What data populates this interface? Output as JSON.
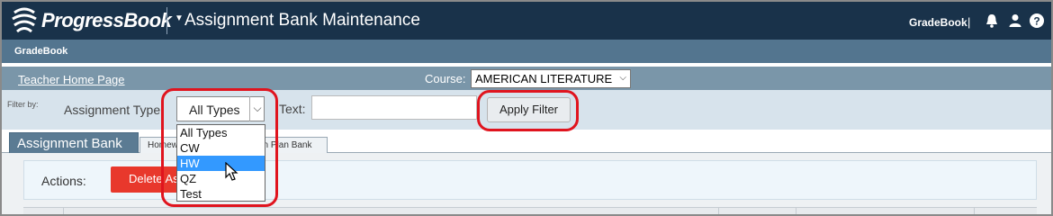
{
  "header": {
    "brand": "ProgressBook",
    "app_title": "Assignment Bank Maintenance",
    "gradebook_link": "GradeBook",
    "separator": "|",
    "icons": [
      "bell-icon",
      "user-icon",
      "help-icon"
    ]
  },
  "subbar": {
    "label": "GradeBook"
  },
  "nav": {
    "teacher_home": "Teacher Home Page",
    "course_label": "Course:",
    "course_value": "AMERICAN LITERATURE"
  },
  "filter": {
    "filter_by": "Filter by:",
    "assignment_type_label": "Assignment Type:",
    "assignment_type_value": "All Types",
    "text_label": "Text:",
    "text_value": "",
    "apply_button": "Apply Filter",
    "options": [
      "All Types",
      "CW",
      "HW",
      "QZ",
      "Test"
    ],
    "hovered_option": "HW"
  },
  "tabs": {
    "active": "Assignment Bank",
    "others": [
      "Homew",
      "on Plan Bank"
    ]
  },
  "actions": {
    "label": "Actions:",
    "delete_button": "Delete As"
  },
  "colors": {
    "header_bg": "#19324a",
    "subbar_bg": "#53758f",
    "nav_bg": "#7a96a9",
    "filter_bg": "#d7e3ec",
    "delete_red": "#e8382c",
    "highlight_red": "#e0141e",
    "selection_blue": "#3399ff"
  }
}
